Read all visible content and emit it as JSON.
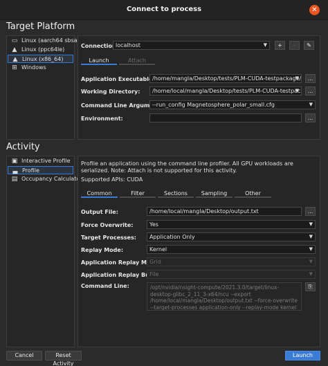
{
  "window": {
    "title": "Connect to process",
    "close_glyph": "✕"
  },
  "target_platform": {
    "heading": "Target Platform",
    "platforms": [
      {
        "label": "Linux (aarch64 sbsa)",
        "icon": "monitor-icon"
      },
      {
        "label": "Linux (ppc64le)",
        "icon": "linux-icon"
      },
      {
        "label": "Linux (x86_64)",
        "icon": "linux-icon",
        "selected": true
      },
      {
        "label": "Windows",
        "icon": "windows-icon"
      }
    ],
    "connection_label": "Connection:",
    "connection_value": "localhost",
    "add_glyph": "+",
    "remove_glyph": "–",
    "edit_glyph": "✎",
    "tabs": [
      "Launch",
      "Attach"
    ],
    "app_exe_label": "Application Executable:",
    "app_exe_value": "/home/mangla/Desktop/tests/PLM-CUDA-testpackage/vla",
    "workdir_label": "Working Directory:",
    "workdir_value": "/home/local/mangla/Desktop/tests/PLM-CUDA-testpackage",
    "args_label": "Command Line Arguments:",
    "args_value": "--run_config Magnetosphere_polar_small.cfg",
    "env_label": "Environment:",
    "env_value": "",
    "browse_glyph": "..."
  },
  "activity": {
    "heading": "Activity",
    "items": [
      {
        "label": "Interactive Profile",
        "icon": "interactive-profile-icon"
      },
      {
        "label": "Profile",
        "icon": "profile-chart-icon",
        "selected": true
      },
      {
        "label": "Occupancy Calculator",
        "icon": "calculator-icon"
      }
    ],
    "description": "Profile an application using the command line profiler. All GPU workloads are serialized. Note: Attach is not supported for this activity.",
    "supported_apis": "Supported APIs: CUDA",
    "tabs": [
      "Common",
      "Filter",
      "Sections",
      "Sampling",
      "Other"
    ],
    "output_file_label": "Output File:",
    "output_file_value": "/home/local/mangla/Desktop/output.txt",
    "force_overwrite_label": "Force Overwrite:",
    "force_overwrite_value": "Yes",
    "target_processes_label": "Target Processes:",
    "target_processes_value": "Application Only",
    "replay_mode_label": "Replay Mode:",
    "replay_mode_value": "Kernel",
    "app_replay_match_label": "Application Replay Match:",
    "app_replay_match_value": "Grid",
    "app_replay_buffer_label": "Application Replay Buffer:",
    "app_replay_buffer_value": "File",
    "command_line_label": "Command Line:",
    "command_line_value": "/opt/nvidia/nsight-compute/2021.3.0/target/linux-desktop-glibc_2_11_3-x64/ncu --export /home/local/mangla/Desktop/output.txt --force-overwrite --target-processes application-only --replay-mode kernel --kernel-name-base",
    "copy_glyph": "⎘"
  },
  "footer": {
    "cancel": "Cancel",
    "reset": "Reset Activity",
    "launch": "Launch"
  },
  "colors": {
    "accent": "#3a7bd5",
    "close": "#e95420"
  }
}
